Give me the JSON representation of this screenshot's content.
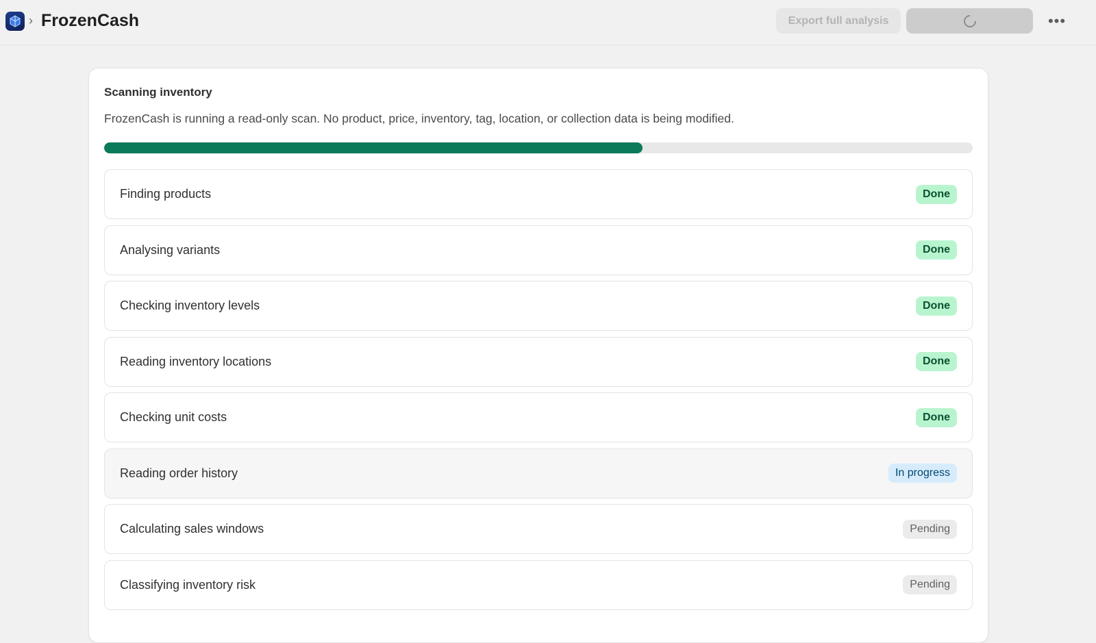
{
  "header": {
    "app_name": "FrozenCash",
    "export_label": "Export full analysis",
    "more_label": "•••"
  },
  "scan": {
    "title": "Scanning inventory",
    "description": "FrozenCash is running a read-only scan. No product, price, inventory, tag, location, or collection data is being modified.",
    "progress": 0.62
  },
  "steps": [
    {
      "label": "Finding products",
      "status": "Done",
      "kind": "done"
    },
    {
      "label": "Analysing variants",
      "status": "Done",
      "kind": "done"
    },
    {
      "label": "Checking inventory levels",
      "status": "Done",
      "kind": "done"
    },
    {
      "label": "Reading inventory locations",
      "status": "Done",
      "kind": "done"
    },
    {
      "label": "Checking unit costs",
      "status": "Done",
      "kind": "done"
    },
    {
      "label": "Reading order history",
      "status": "In progress",
      "kind": "progress"
    },
    {
      "label": "Calculating sales windows",
      "status": "Pending",
      "kind": "pending"
    },
    {
      "label": "Classifying inventory risk",
      "status": "Pending",
      "kind": "pending"
    }
  ],
  "colors": {
    "progress_fill": "#0a7a5a",
    "done_badge": "#b8f5cf",
    "in_progress_badge": "#d6ecfc",
    "pending_badge": "#ebebeb"
  }
}
